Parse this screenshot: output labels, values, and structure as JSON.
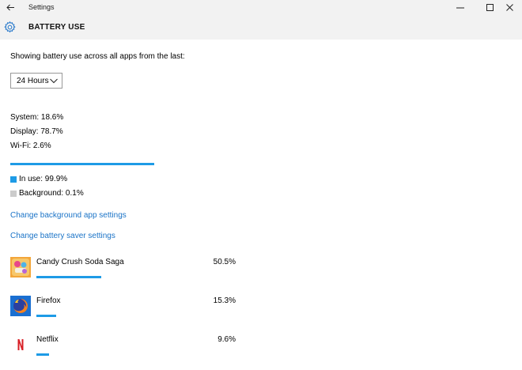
{
  "window": {
    "title": "Settings",
    "controls": [
      "minimize",
      "maximize",
      "close"
    ]
  },
  "header": {
    "title": "BATTERY USE",
    "icon": "gear-icon"
  },
  "main": {
    "caption": "Showing battery use across all apps from the last:",
    "period_select": {
      "selected": "24 Hours"
    },
    "stats": {
      "system": "System: 18.6%",
      "display": "Display: 78.7%",
      "wifi": "Wi-Fi: 2.6%"
    },
    "usage_bar": {
      "in_use_fraction": 0.999
    },
    "legend": {
      "in_use": "In use: 99.9%",
      "background": "Background: 0.1%"
    },
    "links": {
      "background_apps": "Change background app settings",
      "battery_saver": "Change battery saver settings"
    },
    "apps": [
      {
        "name": "Candy Crush Soda Saga",
        "percent_label": "50.5%",
        "fraction": 0.325,
        "icon": "candy-crush-icon"
      },
      {
        "name": "Firefox",
        "percent_label": "15.3%",
        "fraction": 0.1,
        "icon": "firefox-icon"
      },
      {
        "name": "Netflix",
        "percent_label": "9.6%",
        "fraction": 0.062,
        "icon": "netflix-icon"
      }
    ]
  },
  "colors": {
    "accent": "#1e9be6",
    "link": "#1a73c7",
    "header_bg": "#f2f2f2",
    "background_swatch": "#cccccc"
  }
}
